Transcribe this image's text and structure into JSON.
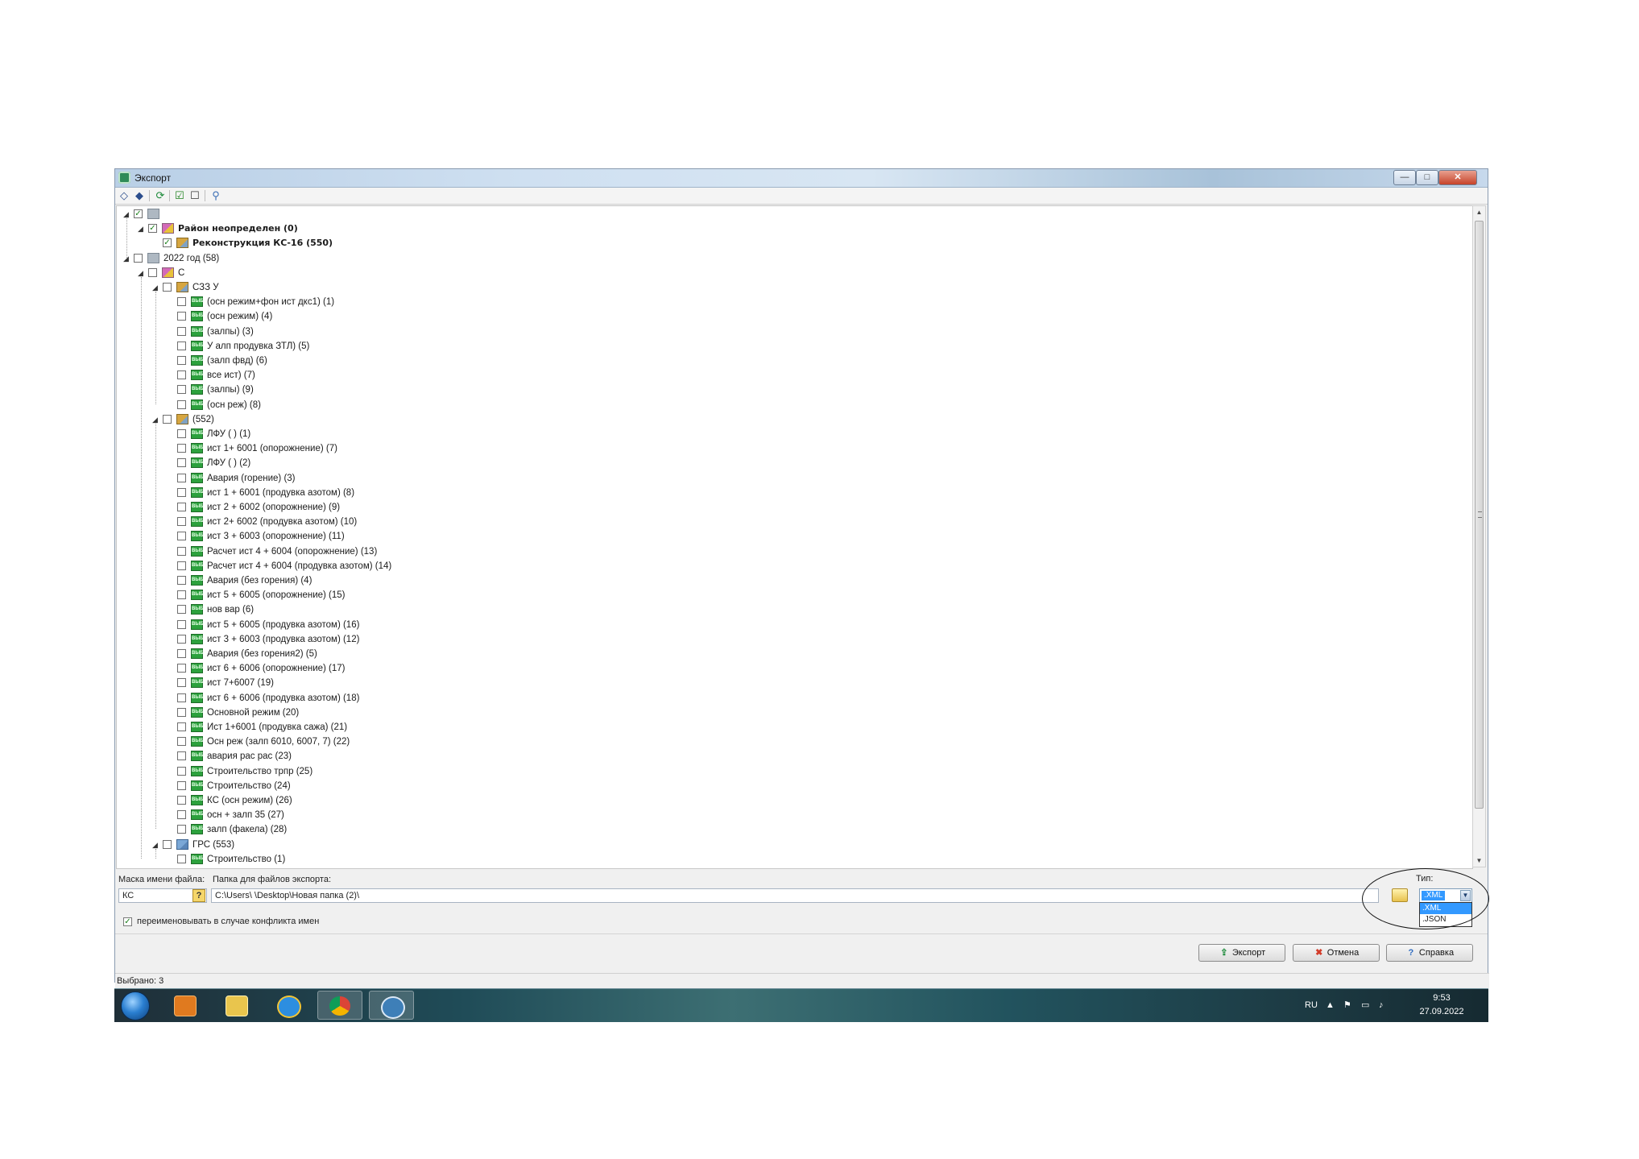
{
  "window": {
    "title": "Экспорт",
    "buttons": {
      "minimize": "—",
      "maximize": "□",
      "close": "✕"
    }
  },
  "toolbar": {
    "icons": [
      "expand-all-icon",
      "collapse-all-icon",
      "refresh-icon",
      "check-all-icon",
      "uncheck-all-icon",
      "search-icon"
    ]
  },
  "tree": {
    "rows": [
      {
        "level": 0,
        "toggle": "◢",
        "checked": true,
        "icon": "folder",
        "label": "",
        "bold": false
      },
      {
        "level": 1,
        "toggle": "◢",
        "checked": true,
        "icon": "region",
        "label": "Район неопределен (0)",
        "bold": true
      },
      {
        "level": 2,
        "toggle": "",
        "checked": true,
        "icon": "object",
        "label": "Реконструкция КС-16 (550)",
        "bold": true
      },
      {
        "level": 0,
        "toggle": "◢",
        "checked": false,
        "icon": "folder",
        "label": "2022 год (58)",
        "bold": false
      },
      {
        "level": 1,
        "toggle": "◢",
        "checked": false,
        "icon": "region",
        "label": "С",
        "bold": false
      },
      {
        "level": 2,
        "toggle": "◢",
        "checked": false,
        "icon": "object",
        "label": "СЗЗ У",
        "bold": false
      },
      {
        "level": 3,
        "toggle": "",
        "checked": false,
        "icon": "calc",
        "label": "(осн режим+фон ист дкс1) (1)",
        "bold": false
      },
      {
        "level": 3,
        "toggle": "",
        "checked": false,
        "icon": "calc",
        "label": "(осн режим) (4)",
        "bold": false
      },
      {
        "level": 3,
        "toggle": "",
        "checked": false,
        "icon": "calc",
        "label": "(залпы) (3)",
        "bold": false
      },
      {
        "level": 3,
        "toggle": "",
        "checked": false,
        "icon": "calc",
        "label": "У  алп продувка ЗТЛ) (5)",
        "bold": false
      },
      {
        "level": 3,
        "toggle": "",
        "checked": false,
        "icon": "calc",
        "label": "(залп фвд) (6)",
        "bold": false
      },
      {
        "level": 3,
        "toggle": "",
        "checked": false,
        "icon": "calc",
        "label": "все ист) (7)",
        "bold": false
      },
      {
        "level": 3,
        "toggle": "",
        "checked": false,
        "icon": "calc",
        "label": "(залпы) (9)",
        "bold": false
      },
      {
        "level": 3,
        "toggle": "",
        "checked": false,
        "icon": "calc",
        "label": "(осн реж) (8)",
        "bold": false
      },
      {
        "level": 2,
        "toggle": "◢",
        "checked": false,
        "icon": "object",
        "label": "(552)",
        "bold": false
      },
      {
        "level": 3,
        "toggle": "",
        "checked": false,
        "icon": "calc",
        "label": "ЛФУ (  ) (1)",
        "bold": false
      },
      {
        "level": 3,
        "toggle": "",
        "checked": false,
        "icon": "calc",
        "label": "ист 1+ 6001 (опорожнение) (7)",
        "bold": false
      },
      {
        "level": 3,
        "toggle": "",
        "checked": false,
        "icon": "calc",
        "label": "ЛФУ (  ) (2)",
        "bold": false
      },
      {
        "level": 3,
        "toggle": "",
        "checked": false,
        "icon": "calc",
        "label": "Авария (горение) (3)",
        "bold": false
      },
      {
        "level": 3,
        "toggle": "",
        "checked": false,
        "icon": "calc",
        "label": "ист 1 + 6001 (продувка азотом) (8)",
        "bold": false
      },
      {
        "level": 3,
        "toggle": "",
        "checked": false,
        "icon": "calc",
        "label": "ист 2 + 6002 (опорожнение) (9)",
        "bold": false
      },
      {
        "level": 3,
        "toggle": "",
        "checked": false,
        "icon": "calc",
        "label": "ист 2+ 6002 (продувка азотом) (10)",
        "bold": false
      },
      {
        "level": 3,
        "toggle": "",
        "checked": false,
        "icon": "calc",
        "label": "ист 3 +  6003 (опорожнение) (11)",
        "bold": false
      },
      {
        "level": 3,
        "toggle": "",
        "checked": false,
        "icon": "calc",
        "label": "Расчет ист 4 + 6004 (опорожнение) (13)",
        "bold": false
      },
      {
        "level": 3,
        "toggle": "",
        "checked": false,
        "icon": "calc",
        "label": "Расчет ист 4 + 6004 (продувка азотом) (14)",
        "bold": false
      },
      {
        "level": 3,
        "toggle": "",
        "checked": false,
        "icon": "calc",
        "label": "Авария (без горения) (4)",
        "bold": false
      },
      {
        "level": 3,
        "toggle": "",
        "checked": false,
        "icon": "calc",
        "label": "ист 5 + 6005 (опорожнение) (15)",
        "bold": false
      },
      {
        "level": 3,
        "toggle": "",
        "checked": false,
        "icon": "calc",
        "label": "нов вар (6)",
        "bold": false
      },
      {
        "level": 3,
        "toggle": "",
        "checked": false,
        "icon": "calc",
        "label": "ист 5 + 6005 (продувка азотом) (16)",
        "bold": false
      },
      {
        "level": 3,
        "toggle": "",
        "checked": false,
        "icon": "calc",
        "label": "ист 3 +  6003 (продувка азотом) (12)",
        "bold": false
      },
      {
        "level": 3,
        "toggle": "",
        "checked": false,
        "icon": "calc",
        "label": "Авария (без горения2) (5)",
        "bold": false
      },
      {
        "level": 3,
        "toggle": "",
        "checked": false,
        "icon": "calc",
        "label": "ист 6 + 6006 (опорожнение) (17)",
        "bold": false
      },
      {
        "level": 3,
        "toggle": "",
        "checked": false,
        "icon": "calc",
        "label": "ист 7+6007 (19)",
        "bold": false
      },
      {
        "level": 3,
        "toggle": "",
        "checked": false,
        "icon": "calc",
        "label": "ист 6 + 6006 (продувка азотом) (18)",
        "bold": false
      },
      {
        "level": 3,
        "toggle": "",
        "checked": false,
        "icon": "calc",
        "label": "Основной режим (20)",
        "bold": false
      },
      {
        "level": 3,
        "toggle": "",
        "checked": false,
        "icon": "calc",
        "label": "Ист 1+6001 (продувка сажа) (21)",
        "bold": false
      },
      {
        "level": 3,
        "toggle": "",
        "checked": false,
        "icon": "calc",
        "label": "Осн реж (залп 6010, 6007, 7) (22)",
        "bold": false
      },
      {
        "level": 3,
        "toggle": "",
        "checked": false,
        "icon": "calc",
        "label": "авария рас рас (23)",
        "bold": false
      },
      {
        "level": 3,
        "toggle": "",
        "checked": false,
        "icon": "calc",
        "label": "Строительство трпр (25)",
        "bold": false
      },
      {
        "level": 3,
        "toggle": "",
        "checked": false,
        "icon": "calc",
        "label": "Строительство (24)",
        "bold": false
      },
      {
        "level": 3,
        "toggle": "",
        "checked": false,
        "icon": "calc",
        "label": "КС (осн режим) (26)",
        "bold": false
      },
      {
        "level": 3,
        "toggle": "",
        "checked": false,
        "icon": "calc",
        "label": "осн + залп 35 (27)",
        "bold": false
      },
      {
        "level": 3,
        "toggle": "",
        "checked": false,
        "icon": "calc",
        "label": "залп (факела) (28)",
        "bold": false
      },
      {
        "level": 2,
        "toggle": "◢",
        "checked": false,
        "icon": "grs",
        "label": "ГРС  (553)",
        "bold": false
      },
      {
        "level": 3,
        "toggle": "",
        "checked": false,
        "icon": "calc",
        "label": "Строительство (1)",
        "bold": false
      }
    ]
  },
  "export_form": {
    "mask_label": "Маска имени файла:",
    "mask_value": "КС",
    "help_glyph": "?",
    "folder_label": "Папка для файлов экспорта:",
    "folder_value": "C:\\Users\\ \\Desktop\\Новая папка (2)\\",
    "type_label": "Тип:",
    "type_selected": ".XML",
    "type_options": [
      ".XML",
      ".JSON"
    ],
    "rename_label": "переименовывать в случае конфликта имен",
    "rename_checked": true
  },
  "buttons": {
    "export": "Экспорт",
    "cancel": "Отмена",
    "help": "Справка"
  },
  "status": {
    "selected": "Выбрано: 3"
  },
  "taskbar": {
    "apps": [
      "media-player",
      "file-explorer",
      "internet-explorer",
      "chrome",
      "export-app"
    ],
    "language": "RU",
    "time": "9:53",
    "date": "27.09.2022"
  }
}
